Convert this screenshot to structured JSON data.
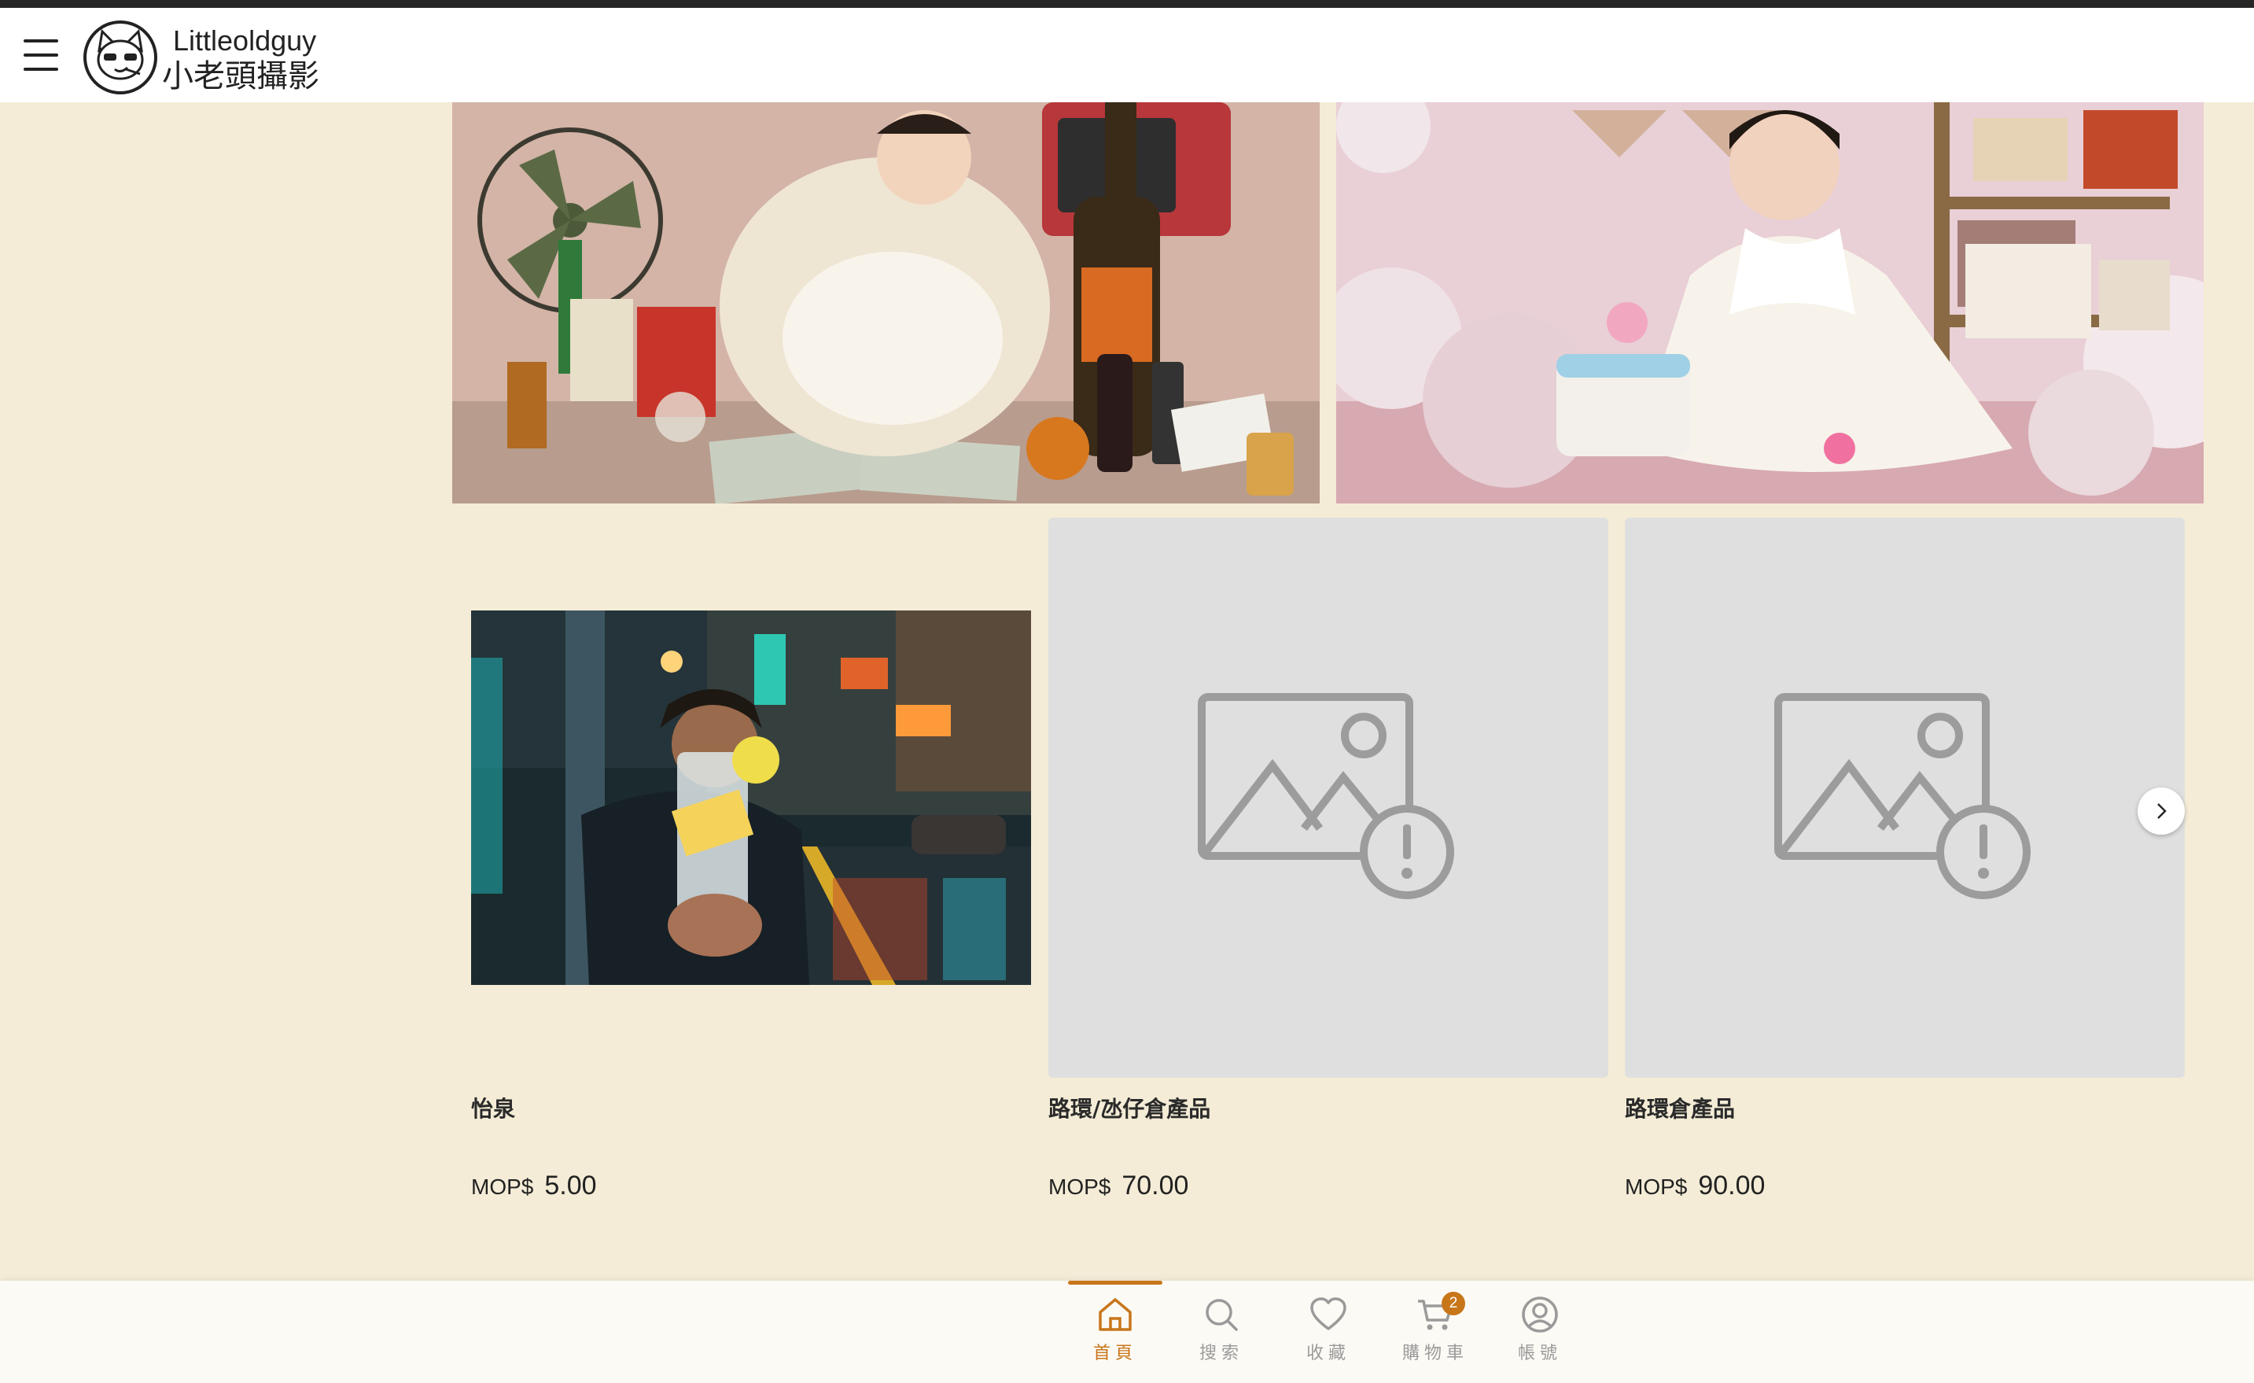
{
  "header": {
    "brand_en": "Littleoldguy",
    "brand_zh": "小老頭攝影"
  },
  "products": [
    {
      "name": "怡泉",
      "currency": "MOP$",
      "price": "5.00",
      "image": "photo"
    },
    {
      "name": "路環/氹仔倉產品",
      "currency": "MOP$",
      "price": "70.00",
      "image": "placeholder"
    },
    {
      "name": "路環倉產品",
      "currency": "MOP$",
      "price": "90.00",
      "image": "placeholder"
    }
  ],
  "bottom_nav": {
    "items": [
      {
        "label": "首頁",
        "icon": "home-icon",
        "active": true
      },
      {
        "label": "搜索",
        "icon": "search-icon",
        "active": false
      },
      {
        "label": "收藏",
        "icon": "heart-icon",
        "active": false
      },
      {
        "label": "購物車",
        "icon": "cart-icon",
        "active": false,
        "badge": "2"
      },
      {
        "label": "帳號",
        "icon": "user-icon",
        "active": false
      }
    ]
  },
  "colors": {
    "background": "#f4ecd6",
    "accent": "#c8761a",
    "placeholder": "#dfdfdf"
  }
}
